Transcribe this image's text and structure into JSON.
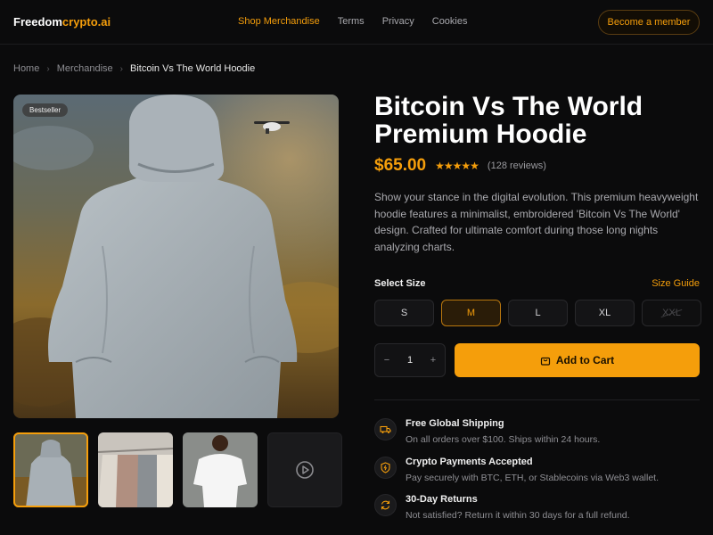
{
  "brand": {
    "name_part1": "Freedom",
    "name_part2": "crypto.ai",
    "accent_color": "#f59e0b"
  },
  "nav": {
    "items": [
      {
        "label": "Shop Merchandise",
        "active": true
      },
      {
        "label": "Terms",
        "active": false
      },
      {
        "label": "Privacy",
        "active": false
      },
      {
        "label": "Cookies",
        "active": false
      }
    ],
    "cta_label": "Become a member"
  },
  "breadcrumb": {
    "items": [
      "Home",
      "Merchandise"
    ],
    "current": "Bitcoin Vs The World Hoodie",
    "separator_icon": "chevron-right-icon"
  },
  "gallery": {
    "badge": "Bestseller",
    "thumbnails": [
      {
        "name": "grey hoodie back",
        "selected": true
      },
      {
        "name": "hanging garments",
        "selected": false
      },
      {
        "name": "white t-shirt",
        "selected": false
      },
      {
        "name": "video",
        "icon": "play-circle-icon",
        "selected": false
      }
    ]
  },
  "product": {
    "title": "Bitcoin Vs The World Premium Hoodie",
    "price": "$65.00",
    "rating": 4.5,
    "stars": "★★★★★",
    "reviews": "(128 reviews)",
    "description": "Show your stance in the digital evolution. This premium heavyweight hoodie features a minimalist, embroidered 'Bitcoin Vs The World' design. Crafted for ultimate comfort during those long nights analyzing charts."
  },
  "size": {
    "label": "Select Size",
    "guide_label": "Size Guide",
    "options": [
      {
        "label": "S",
        "state": "default"
      },
      {
        "label": "M",
        "state": "selected"
      },
      {
        "label": "L",
        "state": "default"
      },
      {
        "label": "XL",
        "state": "default"
      },
      {
        "label": "XXL",
        "state": "disabled"
      }
    ]
  },
  "cart": {
    "quantity": "1",
    "minus": "−",
    "plus": "+",
    "add_label": "Add to Cart",
    "icon": "shopping-bag-icon"
  },
  "features": [
    {
      "icon": "truck-icon",
      "title": "Free Global Shipping",
      "subtitle": "On all orders over $100. Ships within 24 hours."
    },
    {
      "icon": "shield-icon",
      "title": "Crypto Payments Accepted",
      "subtitle": "Pay securely with BTC, ETH, or Stablecoins via Web3 wallet."
    },
    {
      "icon": "refresh-icon",
      "title": "30-Day Returns",
      "subtitle": "Not satisfied? Return it within 30 days for a full refund."
    }
  ]
}
